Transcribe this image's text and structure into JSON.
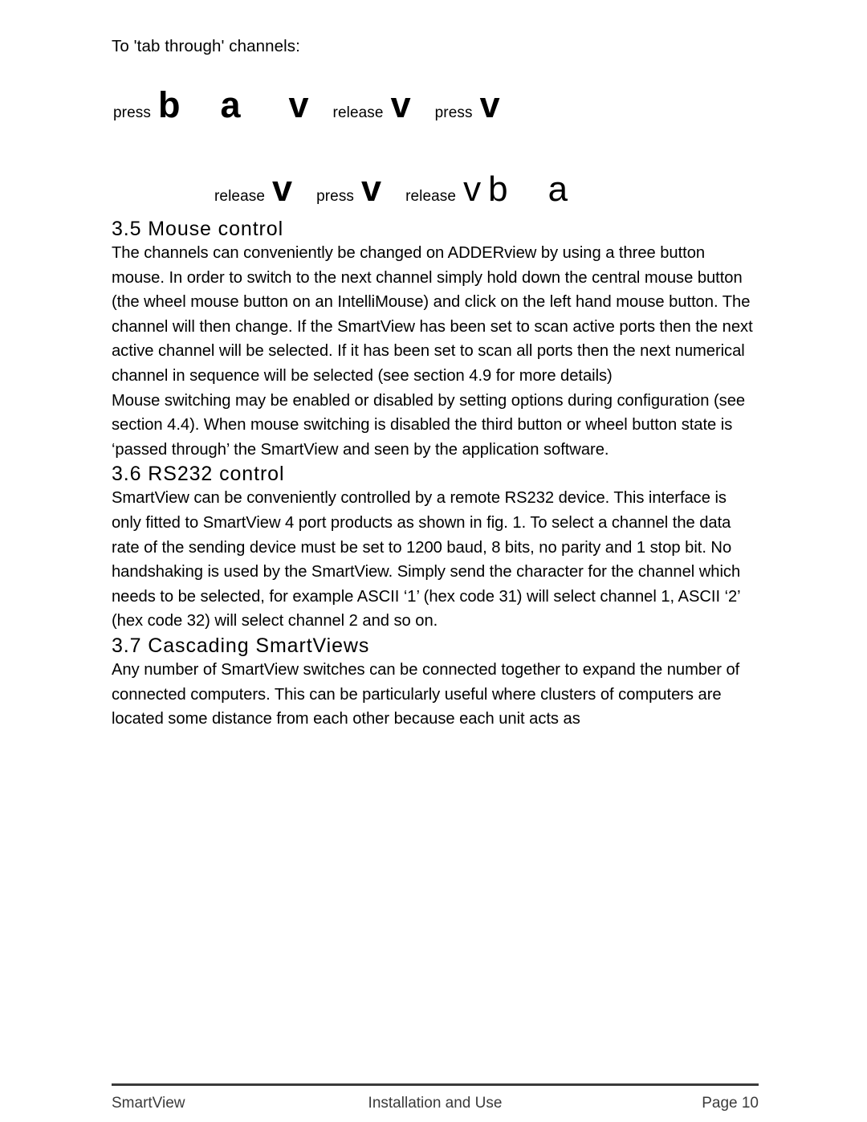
{
  "document": {
    "intro_line": "To 'tab through' channels:"
  },
  "key_sequence": {
    "row1": [
      {
        "type": "word",
        "text": "press"
      },
      {
        "type": "key",
        "text": "b",
        "weight": "bold"
      },
      {
        "type": "key",
        "text": "a",
        "weight": "bold"
      },
      {
        "type": "key",
        "text": "v",
        "weight": "bold"
      },
      {
        "type": "word",
        "text": "release"
      },
      {
        "type": "key",
        "text": "v",
        "weight": "bold"
      },
      {
        "type": "word",
        "text": "press"
      },
      {
        "type": "key",
        "text": "v",
        "weight": "bold"
      }
    ],
    "row2": [
      {
        "type": "word",
        "text": "release"
      },
      {
        "type": "key",
        "text": "v",
        "weight": "bold"
      },
      {
        "type": "word",
        "text": "press"
      },
      {
        "type": "key",
        "text": "v",
        "weight": "bold"
      },
      {
        "type": "word",
        "text": "release"
      },
      {
        "type": "key",
        "text": "v",
        "weight": "light"
      },
      {
        "type": "key",
        "text": "b",
        "weight": "light"
      },
      {
        "type": "key",
        "text": "a",
        "weight": "light"
      }
    ]
  },
  "sections": [
    {
      "heading": "3.5 Mouse control",
      "paragraphs": [
        "The channels can conveniently be changed on ADDERview by using a three button mouse. In order to switch to the next channel simply hold down the central mouse button (the wheel mouse button on an IntelliMouse) and click on the left hand mouse button. The channel will then change. If the SmartView has been set to scan active ports then the next active channel will be selected. If it has been set to scan all ports then the next numerical channel in sequence will be selected (see section 4.9 for more details)",
        "Mouse switching may be enabled or disabled by setting options during configuration (see section 4.4). When mouse switching is disabled the third button or wheel button state is ‘passed through’ the SmartView and seen by the application software."
      ]
    },
    {
      "heading": "3.6 RS232 control",
      "paragraphs": [
        "SmartView can be conveniently controlled by a remote RS232 device. This interface is only fitted to SmartView 4 port products as shown in fig. 1. To select a channel the data rate of the sending device must be set to 1200 baud, 8 bits, no parity and 1 stop bit. No handshaking is used by the SmartView. Simply send the character for the channel which needs to be selected, for example ASCII ‘1’ (hex code 31) will select channel 1, ASCII ‘2’ (hex code 32) will select channel 2 and so on."
      ]
    },
    {
      "heading": "3.7 Cascading SmartViews",
      "paragraphs": [
        "Any number of SmartView switches can be connected together to expand the number of connected computers. This can be particularly useful where clusters of computers are located some distance from each other because each unit acts as"
      ]
    }
  ],
  "footer": {
    "left": "SmartView",
    "center": "Installation and Use",
    "right": "Page 10"
  }
}
